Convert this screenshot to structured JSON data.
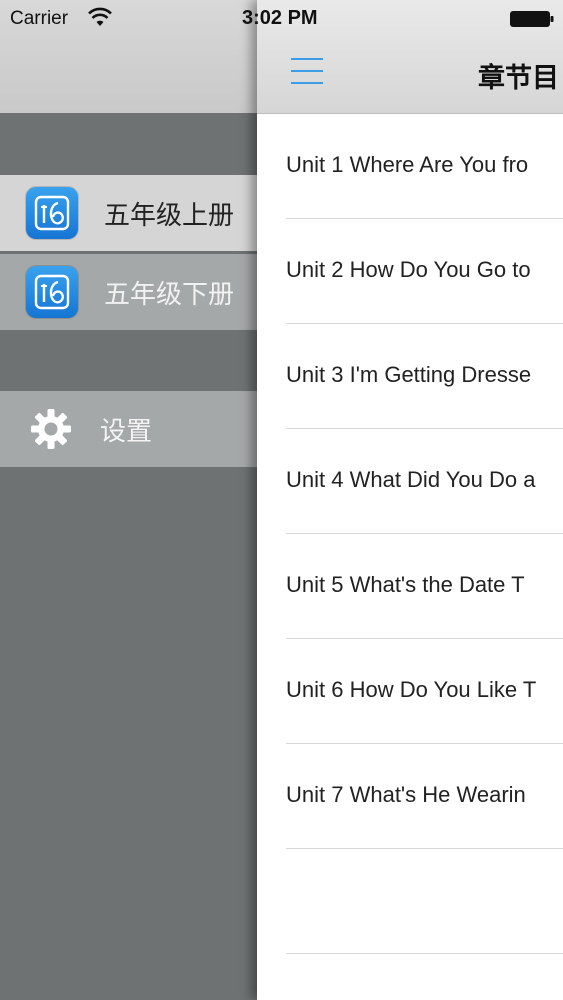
{
  "status_bar": {
    "carrier": "Carrier",
    "time": "3:02 PM"
  },
  "drawer": {
    "items": [
      {
        "label": "五年级上册",
        "icon": "book-app-icon"
      },
      {
        "label": "五年级下册",
        "icon": "book-app-icon"
      },
      {
        "label": "设置",
        "icon": "gear-icon"
      }
    ]
  },
  "navbar": {
    "title": "章节目",
    "menu_icon": "hamburger-menu-icon",
    "accent_color": "#3a9de8"
  },
  "units": [
    {
      "label": "Unit 1 Where Are You fro"
    },
    {
      "label": "Unit 2 How Do You Go to"
    },
    {
      "label": "Unit 3 I'm Getting Dresse"
    },
    {
      "label": "Unit 4 What Did You Do a"
    },
    {
      "label": "Unit 5 What's the Date T"
    },
    {
      "label": "Unit 6 How Do You Like T"
    },
    {
      "label": "Unit 7 What's He Wearin"
    }
  ]
}
